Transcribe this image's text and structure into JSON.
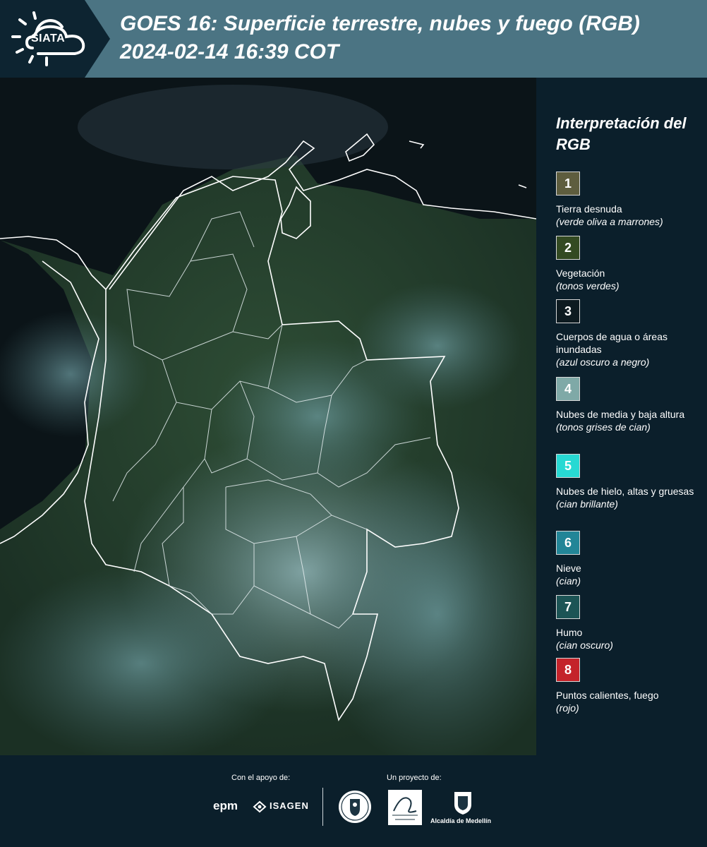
{
  "header": {
    "logo_text": "SIATA",
    "title": "GOES 16: Superficie terrestre, nubes y fuego (RGB)\n 2024-02-14 16:39 COT"
  },
  "legend": {
    "title": "Interpretación del RGB",
    "items": [
      {
        "num": "1",
        "label": "Tierra desnuda",
        "sub": "(verde oliva a marrones)",
        "color": "#5e5d3e"
      },
      {
        "num": "2",
        "label": "Vegetación",
        "sub": "(tonos verdes)",
        "color": "#334a22"
      },
      {
        "num": "3",
        "label": "Cuerpos de agua o áreas inundadas",
        "sub": "(azul oscuro a negro)",
        "color": "#0d1a20"
      },
      {
        "num": "4",
        "label": "Nubes de media y baja altura",
        "sub": "(tonos grises de cian)",
        "color": "#7fa9a7"
      },
      {
        "num": "5",
        "label": "Nubes de hielo, altas y gruesas",
        "sub": "(cian brillante)",
        "color": "#27d9d3"
      },
      {
        "num": "6",
        "label": "Nieve",
        "sub": "(cian)",
        "color": "#228597"
      },
      {
        "num": "7",
        "label": "Humo",
        "sub": "(cian oscuro)",
        "color": "#1c5455"
      },
      {
        "num": "8",
        "label": "Puntos calientes, fuego",
        "sub": "(rojo)",
        "color": "#c4232a"
      }
    ]
  },
  "footer": {
    "support_label": "Con el apoyo de:",
    "project_label": "Un proyecto de:",
    "sponsors": [
      "epm",
      "ISAGEN"
    ],
    "partners": [
      "Área Metropolitana",
      "Alcaldía de Medellín"
    ]
  }
}
